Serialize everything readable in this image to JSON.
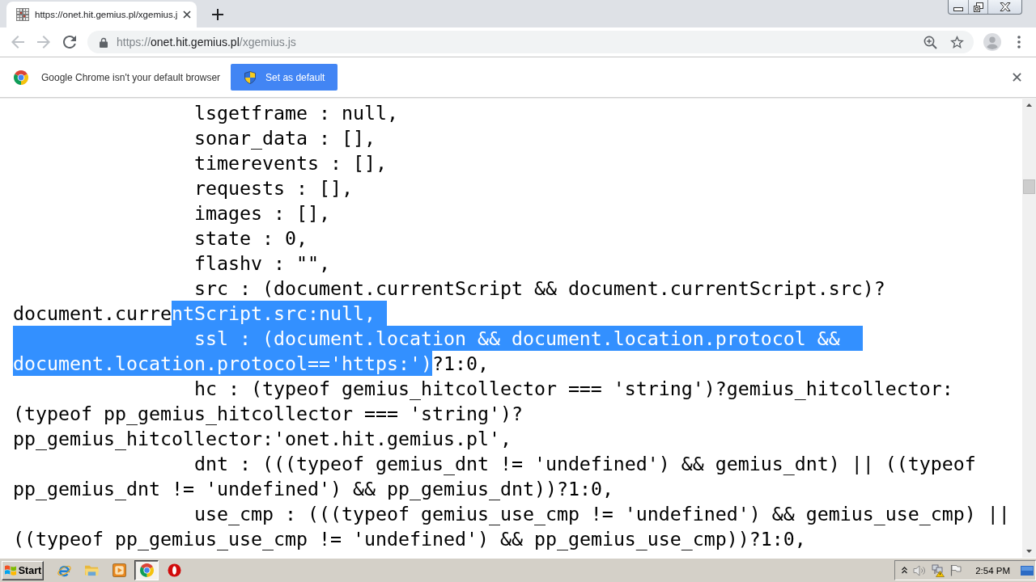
{
  "tabs": [
    {
      "title": "https://onet.hit.gemius.pl/xgemius.j",
      "selected": true
    }
  ],
  "toolbar": {
    "back": {
      "disabled": true
    },
    "forward": {
      "disabled": true
    },
    "url": {
      "scheme": "https://",
      "host": "onet.hit.gemius.pl",
      "path": "/xgemius.js"
    }
  },
  "infobar": {
    "message": "Google Chrome isn't your default browser",
    "button": "Set as default"
  },
  "code": {
    "lines": [
      {
        "kind": "entry",
        "segments": [
          {
            "text": "lsgetframe : null,",
            "selected": false
          }
        ]
      },
      {
        "kind": "entry",
        "segments": [
          {
            "text": "sonar_data : [],",
            "selected": false
          }
        ]
      },
      {
        "kind": "entry",
        "segments": [
          {
            "text": "timerevents : [],",
            "selected": false
          }
        ]
      },
      {
        "kind": "entry",
        "segments": [
          {
            "text": "requests : [],",
            "selected": false
          }
        ]
      },
      {
        "kind": "entry",
        "segments": [
          {
            "text": "images : [],",
            "selected": false
          }
        ]
      },
      {
        "kind": "entry",
        "segments": [
          {
            "text": "state : 0,",
            "selected": false
          }
        ]
      },
      {
        "kind": "entry",
        "segments": [
          {
            "text": "flashv : \"\",",
            "selected": false
          }
        ]
      },
      {
        "kind": "entry",
        "segments": [
          {
            "text": "src : (document.currentScript && document.currentScript.src)?",
            "selected": false
          }
        ]
      },
      {
        "kind": "wrap",
        "segments": [
          {
            "text": "document.curre",
            "selected": false
          },
          {
            "text": "ntScript.src:null,",
            "selected": true
          }
        ]
      },
      {
        "kind": "entry",
        "segments": [
          {
            "text": "ssl : (document.location && document.location.protocol &&",
            "selected": true
          }
        ]
      },
      {
        "kind": "wrap",
        "segments": [
          {
            "text": "document.location.protocol=='https:')",
            "selected": true
          },
          {
            "text": "?1:0,",
            "selected": false
          }
        ]
      },
      {
        "kind": "entry",
        "segments": [
          {
            "text": "hc : (typeof gemius_hitcollector === 'string')?gemius_hitcollector:",
            "selected": false
          }
        ]
      },
      {
        "kind": "wrap",
        "segments": [
          {
            "text": "(typeof pp_gemius_hitcollector === 'string')?",
            "selected": false
          }
        ]
      },
      {
        "kind": "wrap",
        "segments": [
          {
            "text": "pp_gemius_hitcollector:'onet.hit.gemius.pl',",
            "selected": false
          }
        ]
      },
      {
        "kind": "entry",
        "segments": [
          {
            "text": "dnt : (((typeof gemius_dnt != 'undefined') && gemius_dnt) || ((typeof",
            "selected": false
          }
        ]
      },
      {
        "kind": "wrap",
        "segments": [
          {
            "text": "pp_gemius_dnt != 'undefined') && pp_gemius_dnt))?1:0,",
            "selected": false
          }
        ]
      },
      {
        "kind": "entry",
        "segments": [
          {
            "text": "use_cmp : (((typeof gemius_use_cmp != 'undefined') && gemius_use_cmp) ||",
            "selected": false
          }
        ]
      },
      {
        "kind": "wrap",
        "segments": [
          {
            "text": "((typeof pp_gemius_use_cmp != 'undefined') && pp_gemius_use_cmp))?1:0,",
            "selected": false
          }
        ]
      }
    ]
  },
  "taskbar": {
    "start": "Start",
    "apps": [
      {
        "active": false
      },
      {
        "active": false
      },
      {
        "active": false
      },
      {
        "active": true
      },
      {
        "active": false
      }
    ],
    "clock": "2:54 PM"
  }
}
